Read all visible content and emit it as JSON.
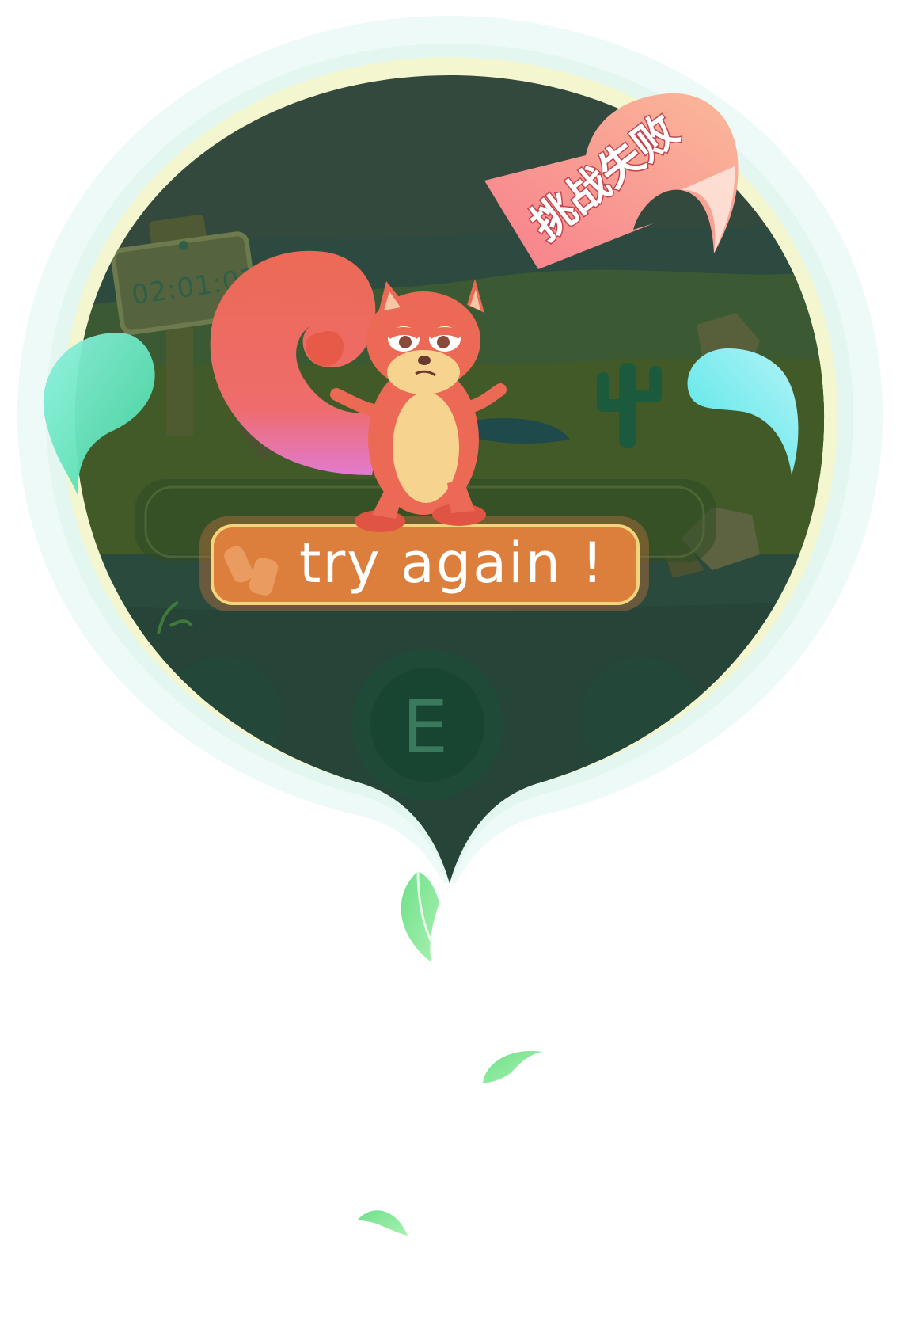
{
  "game": {
    "timer": "02:01:02",
    "keys": [
      "E"
    ],
    "result_banner": "挑战失败",
    "retry_label": "try again !"
  },
  "colors": {
    "scene_dark": "#264a3c",
    "ground": "#3d5a2a",
    "frame_outer": "#e9f8f2",
    "frame_inner": "#f3f7d2",
    "banner": "#f48a8a",
    "retry_button": "#dd7f3c",
    "retry_border": "#f5d57c",
    "squirrel": "#ec6a55",
    "squirrel_belly": "#f6d490",
    "splash": "#79e9c9",
    "leaf": "#67d38f"
  },
  "icons": [
    "stopwatch-icon",
    "cactus-icon",
    "rocks-icon",
    "leaf-icon",
    "squirrel-character"
  ]
}
